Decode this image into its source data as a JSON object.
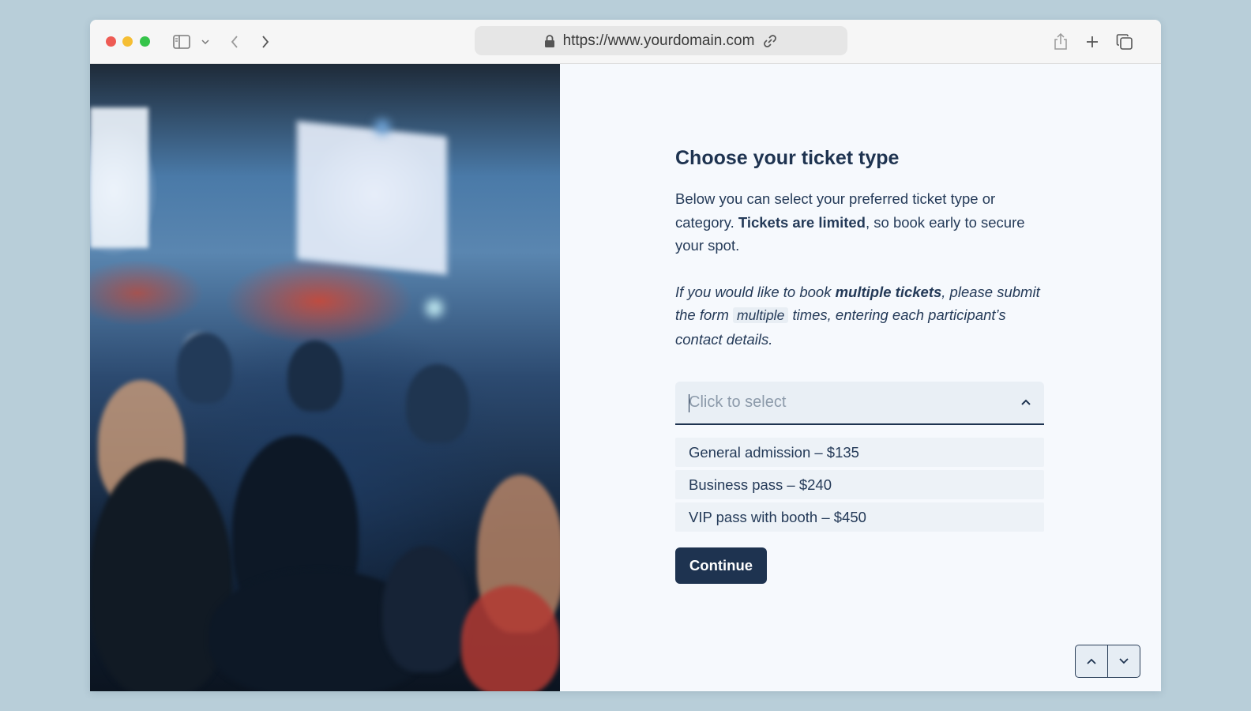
{
  "browser": {
    "url": "https://www.yourdomain.com"
  },
  "form": {
    "title": "Choose your ticket type",
    "intro": {
      "before": "Below you can select your preferred ticket type or category. ",
      "bold": "Tickets are limited",
      "after": ", so book early to secure your spot."
    },
    "note": {
      "before": "If you would like to book ",
      "bold": "multiple tickets",
      "middle": ", please submit the form ",
      "code": "multiple",
      "after": " times, entering each participant’s contact details."
    },
    "select": {
      "placeholder": "Click to select",
      "options": [
        "General admission – $135",
        "Business pass – $240",
        "VIP pass with booth – $450"
      ]
    },
    "continue_label": "Continue"
  }
}
